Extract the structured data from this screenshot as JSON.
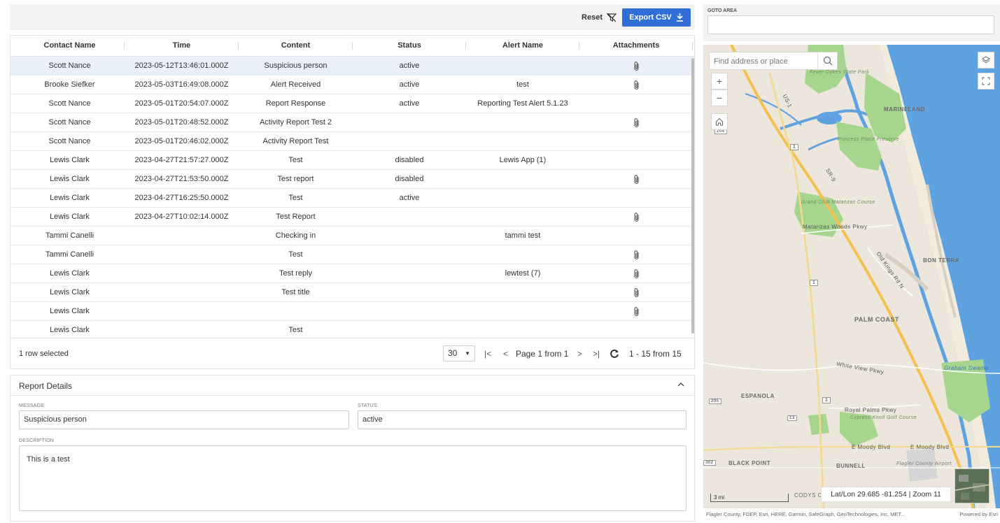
{
  "toolbar": {
    "reset_label": "Reset",
    "export_label": "Export CSV"
  },
  "grid": {
    "columns": [
      "Contact Name",
      "Time",
      "Content",
      "Status",
      "Alert Name",
      "Attachments"
    ],
    "rows": [
      {
        "contact": "Scott Nance",
        "time": "2023-05-12T13:46:01.000Z",
        "content": "Suspicious person",
        "status": "active",
        "alert": "",
        "attachment": true,
        "selected": true
      },
      {
        "contact": "Brooke Siefker",
        "time": "2023-05-03T16:49:08.000Z",
        "content": "Alert Received",
        "status": "active",
        "alert": "test",
        "attachment": true,
        "selected": false
      },
      {
        "contact": "Scott Nance",
        "time": "2023-05-01T20:54:07.000Z",
        "content": "Report Response",
        "status": "active",
        "alert": "Reporting Test Alert 5.1.23",
        "attachment": false,
        "selected": false
      },
      {
        "contact": "Scott Nance",
        "time": "2023-05-01T20:48:52.000Z",
        "content": "Activity Report Test 2",
        "status": "",
        "alert": "",
        "attachment": true,
        "selected": false
      },
      {
        "contact": "Scott Nance",
        "time": "2023-05-01T20:46:02.000Z",
        "content": "Activity Report Test",
        "status": "",
        "alert": "",
        "attachment": false,
        "selected": false
      },
      {
        "contact": "Lewis Clark",
        "time": "2023-04-27T21:57:27.000Z",
        "content": "Test",
        "status": "disabled",
        "alert": "Lewis App (1)",
        "attachment": false,
        "selected": false
      },
      {
        "contact": "Lewis Clark",
        "time": "2023-04-27T21:53:50.000Z",
        "content": "Test report",
        "status": "disabled",
        "alert": "",
        "attachment": true,
        "selected": false
      },
      {
        "contact": "Lewis Clark",
        "time": "2023-04-27T16:25:50.000Z",
        "content": "Test",
        "status": "active",
        "alert": "",
        "attachment": false,
        "selected": false
      },
      {
        "contact": "Lewis Clark",
        "time": "2023-04-27T10:02:14.000Z",
        "content": "Test Report",
        "status": "",
        "alert": "",
        "attachment": true,
        "selected": false
      },
      {
        "contact": "Tammi Canelli",
        "time": "",
        "content": "Checking in",
        "status": "",
        "alert": "tammi test",
        "attachment": false,
        "selected": false
      },
      {
        "contact": "Tammi Canelli",
        "time": "",
        "content": "Test",
        "status": "",
        "alert": "",
        "attachment": true,
        "selected": false
      },
      {
        "contact": "Lewis Clark",
        "time": "",
        "content": "Test reply",
        "status": "",
        "alert": "lewtest (7)",
        "attachment": true,
        "selected": false
      },
      {
        "contact": "Lewis Clark",
        "time": "",
        "content": "Test title",
        "status": "",
        "alert": "",
        "attachment": true,
        "selected": false
      },
      {
        "contact": "Lewis Clark",
        "time": "",
        "content": "",
        "status": "",
        "alert": "",
        "attachment": true,
        "selected": false
      },
      {
        "contact": "Lewis Clark",
        "time": "",
        "content": "Test",
        "status": "",
        "alert": "",
        "attachment": false,
        "selected": false
      }
    ],
    "footer": {
      "selection": "1 row selected",
      "page_size": "30",
      "page_label": "Page 1 from 1",
      "range_label": "1 - 15 from 15"
    }
  },
  "details": {
    "title": "Report Details",
    "message_label": "MESSAGE",
    "message_value": "Suspicious person",
    "status_label": "STATUS",
    "status_value": "active",
    "description_label": "DESCRIPTION",
    "description_value": "This is a test"
  },
  "map": {
    "goto_label": "GOTO AREA",
    "goto_value": "",
    "search_placeholder": "Find address or place",
    "latlon": "Lat/Lon 29.685 -81.254 | Zoom 11",
    "scale_label": "3 mi",
    "attribution": "Flagler County, FDEP, Esri, HERE, Garmin, SafeGraph, GeoTechnologies, Inc, MET...",
    "powered_by": "Powered by Esri",
    "labels": [
      {
        "key": "fever",
        "text": "Fever-Dykes State Park"
      },
      {
        "key": "marineland",
        "text": "MARINELAND"
      },
      {
        "key": "princess",
        "text": "Princess Place Preserve"
      },
      {
        "key": "grandclub",
        "text": "Grand Club Matanzas Course"
      },
      {
        "key": "matanzas",
        "text": "Matanzas Woods Pkwy"
      },
      {
        "key": "bonterra",
        "text": "BON TERRA"
      },
      {
        "key": "oldkings",
        "text": "Old Kings Rd N"
      },
      {
        "key": "palmcoast",
        "text": "PALM COAST"
      },
      {
        "key": "whiteview",
        "text": "White View Pkwy"
      },
      {
        "key": "graham",
        "text": "Graham Swamp"
      },
      {
        "key": "espanola",
        "text": "ESPANOLA"
      },
      {
        "key": "royalpalms",
        "text": "Royal Palms Pkwy"
      },
      {
        "key": "cypress",
        "text": "Cypress Knoll Golf Course"
      },
      {
        "key": "moody1",
        "text": "E Moody Blvd"
      },
      {
        "key": "moody2",
        "text": "E Moody Blvd"
      },
      {
        "key": "blackpoint",
        "text": "BLACK POINT"
      },
      {
        "key": "bunnell",
        "text": "BUNNELL"
      },
      {
        "key": "airport",
        "text": "Flagler County Airport"
      },
      {
        "key": "codys",
        "text": "CODYS CORNER"
      },
      {
        "key": "us1",
        "text": "US-1"
      },
      {
        "key": "sr9",
        "text": "SR-9"
      },
      {
        "key": "r1a",
        "text": "1"
      },
      {
        "key": "r1b",
        "text": "1"
      },
      {
        "key": "r1c",
        "text": "1"
      },
      {
        "key": "r204",
        "text": "204"
      },
      {
        "key": "r205",
        "text": "205"
      },
      {
        "key": "r13",
        "text": "13"
      },
      {
        "key": "r302",
        "text": "302"
      }
    ]
  },
  "colors": {
    "accent": "#2f6fd6",
    "selected_row": "#eaf0f9",
    "water": "#5fa2e0",
    "park": "#a6d58e",
    "highway": "#f2c14e"
  }
}
